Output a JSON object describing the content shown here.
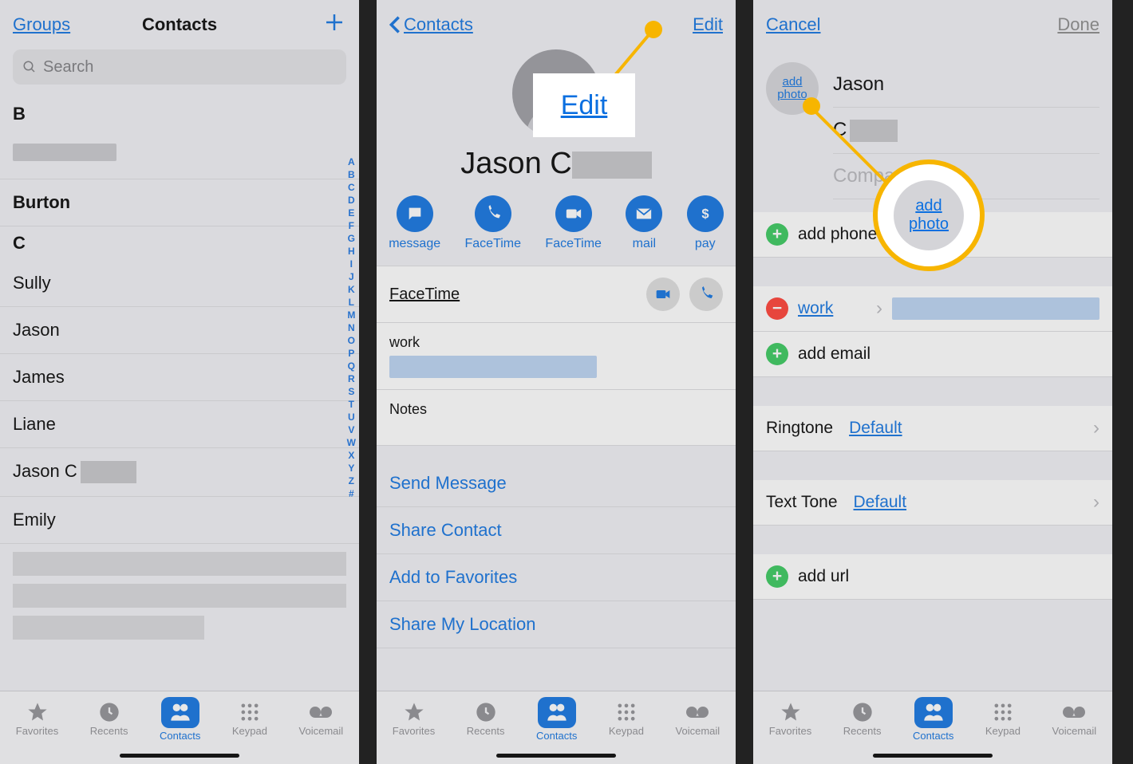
{
  "screen1": {
    "header": {
      "groups": "Groups",
      "title": "Contacts"
    },
    "search_placeholder": "Search",
    "section_B": "B",
    "burton": "Burton",
    "section_C": "C",
    "names": [
      "Sully",
      "Jason",
      "James",
      "Liane",
      "Jason C",
      "Emily"
    ]
  },
  "alpha_index": [
    "A",
    "B",
    "C",
    "D",
    "E",
    "F",
    "G",
    "H",
    "I",
    "J",
    "K",
    "L",
    "M",
    "N",
    "O",
    "P",
    "Q",
    "R",
    "S",
    "T",
    "U",
    "V",
    "W",
    "X",
    "Y",
    "Z",
    "#"
  ],
  "tabbar": {
    "favorites": "Favorites",
    "recents": "Recents",
    "contacts": "Contacts",
    "keypad": "Keypad",
    "voicemail": "Voicemail"
  },
  "screen2": {
    "back": "Contacts",
    "edit": "Edit",
    "name_prefix": "Jason C",
    "actions": {
      "message": "message",
      "facetime_v": "FaceTime",
      "facetime_a": "FaceTime",
      "mail": "mail",
      "pay": "pay"
    },
    "facetime_label": "FaceTime",
    "work_label": "work",
    "notes_label": "Notes",
    "links": {
      "send": "Send Message",
      "share": "Share Contact",
      "fav": "Add to Favorites",
      "loc": "Share My Location"
    },
    "callout_edit": "Edit"
  },
  "screen3": {
    "cancel": "Cancel",
    "done": "Done",
    "add_photo": "add photo",
    "first_name": "Jason",
    "last_prefix": "C",
    "company_placeholder": "Company",
    "add_phone": "add phone",
    "work": "work",
    "add_email": "add email",
    "ringtone_label": "Ringtone",
    "ringtone_value": "Default",
    "texttone_label": "Text Tone",
    "texttone_value": "Default",
    "add_url": "add url",
    "callout_add_photo_1": "add",
    "callout_add_photo_2": "photo"
  }
}
